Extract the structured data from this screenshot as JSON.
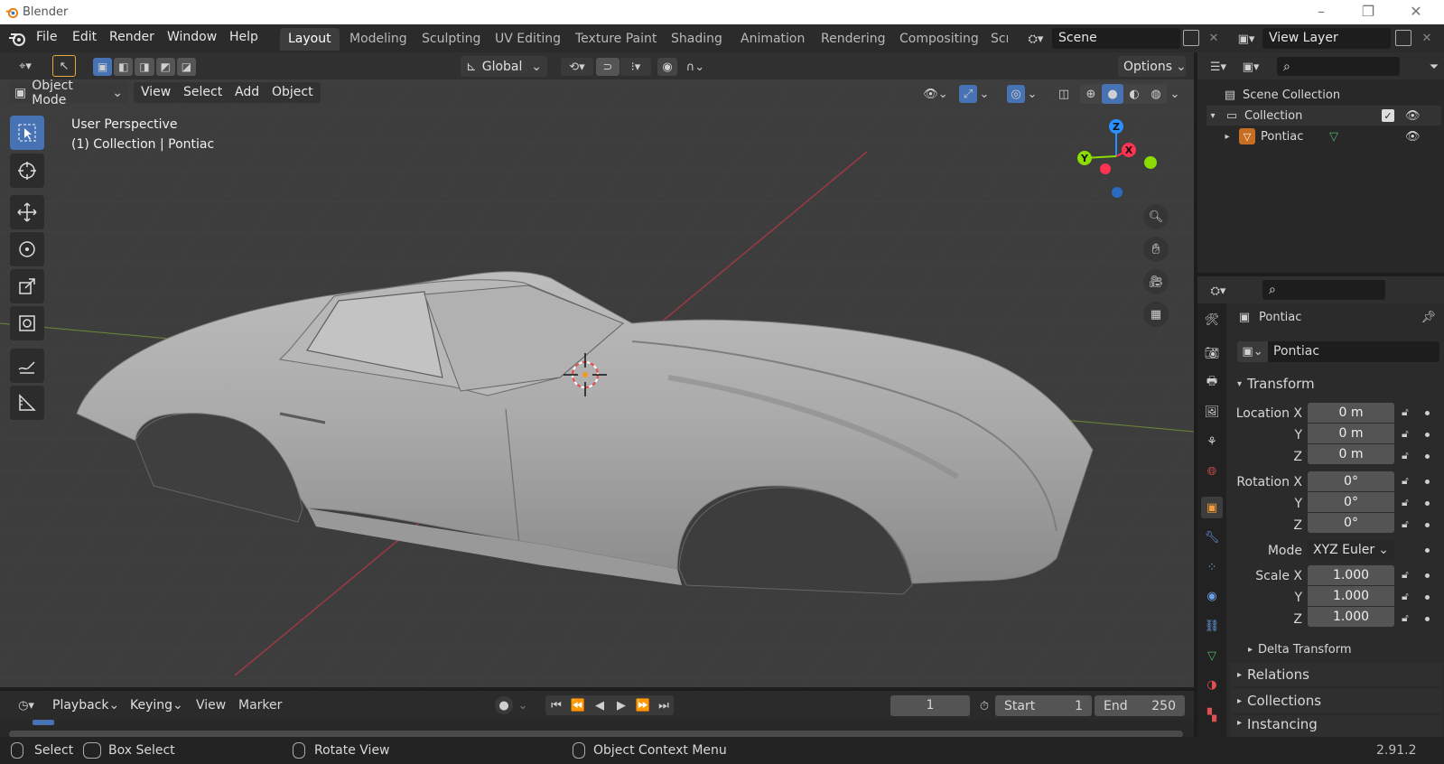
{
  "window": {
    "title": "Blender"
  },
  "menu": [
    "File",
    "Edit",
    "Render",
    "Window",
    "Help"
  ],
  "workspaces": [
    "Layout",
    "Modeling",
    "Sculpting",
    "UV Editing",
    "Texture Paint",
    "Shading",
    "Animation",
    "Rendering",
    "Compositing",
    "Scr"
  ],
  "scene": {
    "name": "Scene"
  },
  "view_layer": {
    "name": "View Layer"
  },
  "viewport_header": {
    "transform_orientation": "Global",
    "options_label": "Options",
    "mode": "Object Mode",
    "menus": [
      "View",
      "Select",
      "Add",
      "Object"
    ]
  },
  "viewport": {
    "perspective": "User Perspective",
    "collection_info": "(1) Collection | Pontiac",
    "gizmo": {
      "z": "Z",
      "y": "Y",
      "x": "X"
    }
  },
  "outliner": {
    "scene_collection": "Scene Collection",
    "collection": "Collection",
    "object": "Pontiac"
  },
  "properties": {
    "object_name": "Pontiac",
    "data_name": "Pontiac",
    "transform_panel": "Transform",
    "location": {
      "label_x": "Location X",
      "label_y": "Y",
      "label_z": "Z",
      "x": "0 m",
      "y": "0 m",
      "z": "0 m"
    },
    "rotation": {
      "label_x": "Rotation X",
      "label_y": "Y",
      "label_z": "Z",
      "x": "0°",
      "y": "0°",
      "z": "0°"
    },
    "mode": {
      "label": "Mode",
      "value": "XYZ Euler"
    },
    "scale": {
      "label_x": "Scale X",
      "label_y": "Y",
      "label_z": "Z",
      "x": "1.000",
      "y": "1.000",
      "z": "1.000"
    },
    "delta_transform": "Delta Transform",
    "relations": "Relations",
    "collections": "Collections",
    "instancing": "Instancing"
  },
  "timeline": {
    "menus": [
      "Playback",
      "Keying",
      "View",
      "Marker"
    ],
    "current_frame": "1",
    "start_label": "Start",
    "start": "1",
    "end_label": "End",
    "end": "250"
  },
  "statusbar": {
    "select": "Select",
    "box_select": "Box Select",
    "rotate_view": "Rotate View",
    "context_menu": "Object Context Menu",
    "version": "2.91.2"
  },
  "colors": {
    "accent": "#4772b3",
    "axis_x": "#ff3352",
    "axis_y": "#8bdc00",
    "axis_z": "#2890ff",
    "viewport_bg": "#3e3e3e"
  }
}
